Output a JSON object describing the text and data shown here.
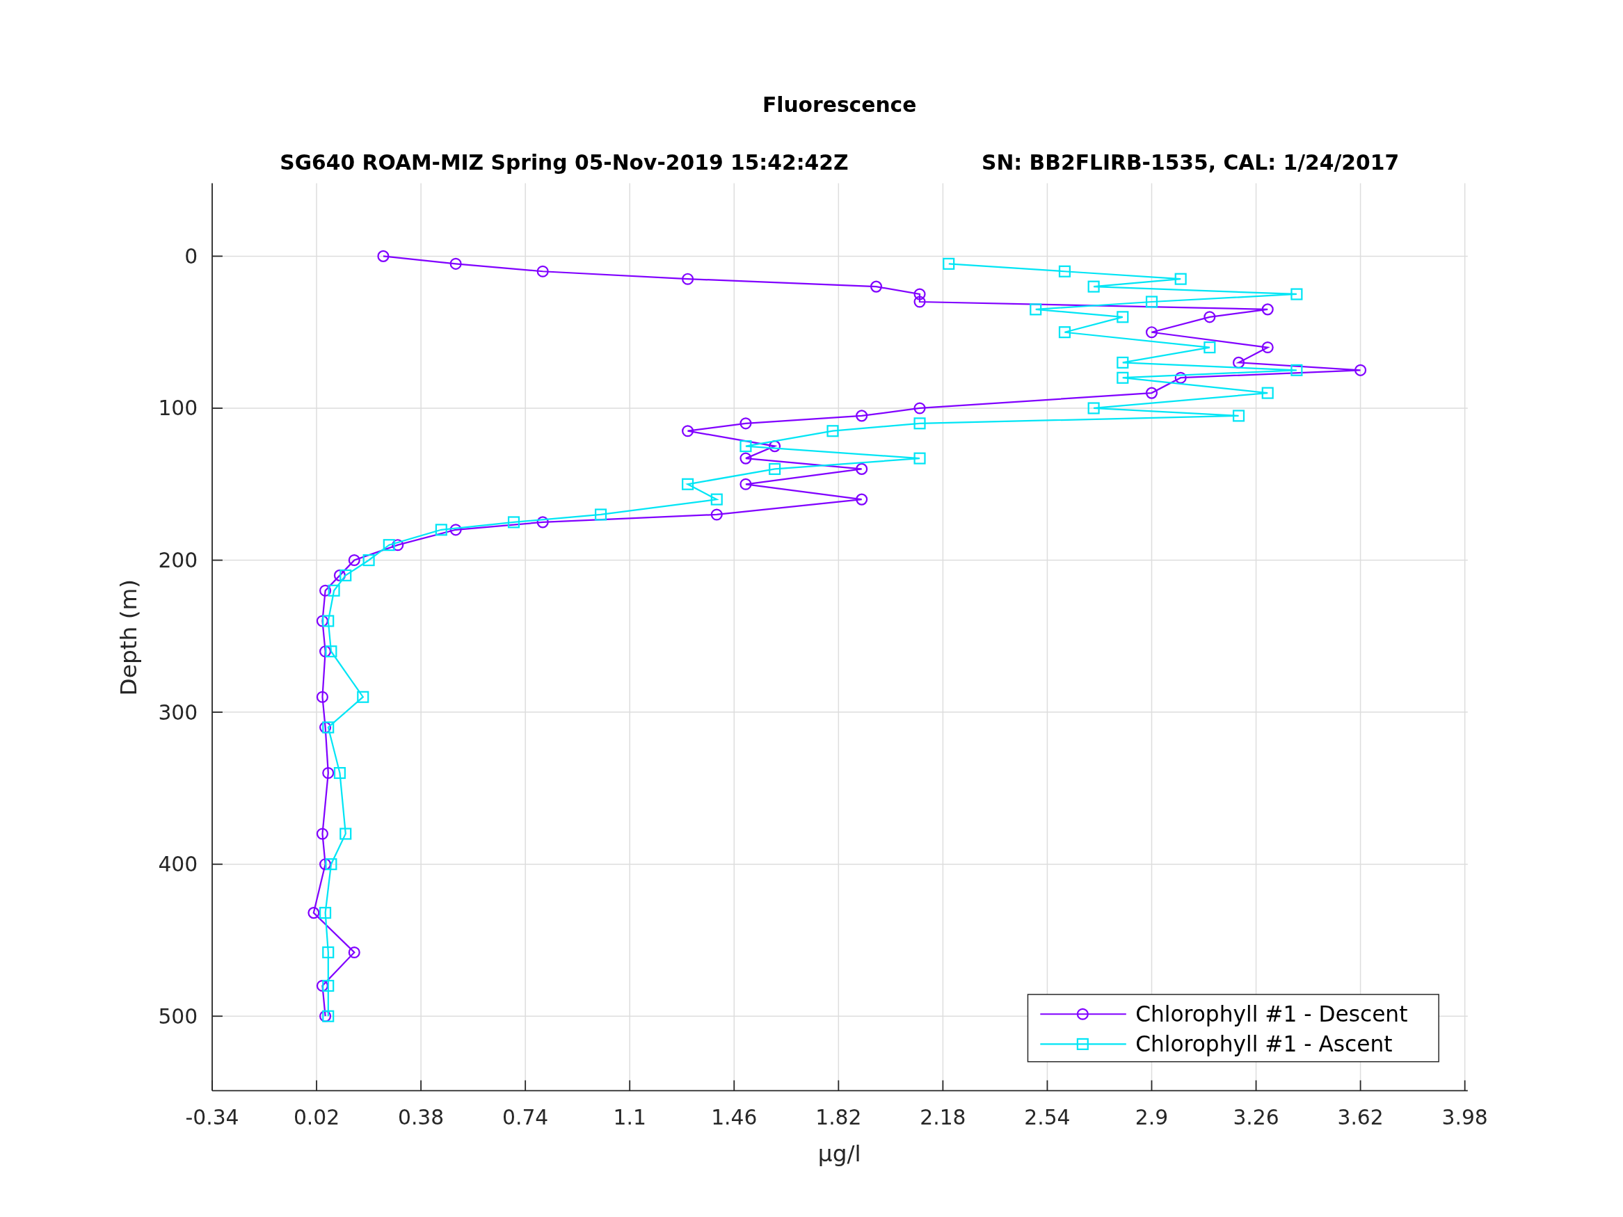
{
  "figure": {
    "title": "Fluorescence",
    "subtitle": [
      "SG640 ROAM-MIZ Spring 05-Nov-2019 15:42:42Z",
      "SN: BB2FLIRB-1535, CAL: 1/24/2017"
    ],
    "chart_data": {
      "type": "line",
      "orientation": "horizontal",
      "grid": true,
      "legend": true,
      "xlabel": "μg/l",
      "ylabel": "Depth (m)",
      "xlim": [
        -0.34,
        3.99
      ],
      "ylim": [
        549,
        -48
      ],
      "xticks": [
        -0.34,
        0.02,
        0.38,
        0.74,
        1.1,
        1.46,
        1.82,
        2.18,
        2.54,
        2.9,
        3.26,
        3.62,
        3.98
      ],
      "yticks": [
        0,
        100,
        200,
        300,
        400,
        500
      ],
      "x": [
        0,
        5,
        10,
        15,
        20,
        25,
        30,
        35,
        40,
        50,
        60,
        70,
        75,
        80,
        90,
        100,
        105,
        110,
        115,
        125,
        133,
        140,
        150,
        160,
        170,
        175,
        180,
        190,
        200,
        210,
        220,
        240,
        260,
        290,
        310,
        340,
        380,
        400,
        432,
        458,
        480,
        500
      ],
      "series": [
        {
          "name": "Chlorophyll #1 - Descent",
          "color": "#8000ff",
          "marker": "o",
          "values": [
            0.25,
            0.5,
            0.8,
            1.3,
            1.95,
            2.1,
            2.1,
            3.3,
            3.1,
            2.9,
            3.3,
            3.2,
            3.62,
            3.0,
            2.9,
            2.1,
            1.9,
            1.5,
            1.3,
            1.6,
            1.5,
            1.9,
            1.5,
            1.9,
            1.4,
            0.8,
            0.5,
            0.3,
            0.15,
            0.1,
            0.05,
            0.04,
            0.05,
            0.04,
            0.05,
            0.06,
            0.04,
            0.05,
            0.01,
            0.15,
            0.04,
            0.05
          ]
        },
        {
          "name": "Chlorophyll #1 - Ascent",
          "color": "#00e5f5",
          "marker": "s",
          "values": [
            null,
            2.2,
            2.6,
            3.0,
            2.7,
            3.4,
            2.9,
            2.5,
            2.8,
            2.6,
            3.1,
            2.8,
            3.4,
            2.8,
            3.3,
            2.7,
            3.2,
            2.1,
            1.8,
            1.5,
            2.1,
            1.6,
            1.3,
            1.4,
            1.0,
            0.7,
            0.45,
            0.27,
            0.2,
            0.12,
            0.08,
            0.06,
            0.07,
            0.18,
            0.06,
            0.1,
            0.12,
            0.07,
            0.05,
            0.06,
            0.06,
            0.06
          ]
        }
      ]
    }
  }
}
